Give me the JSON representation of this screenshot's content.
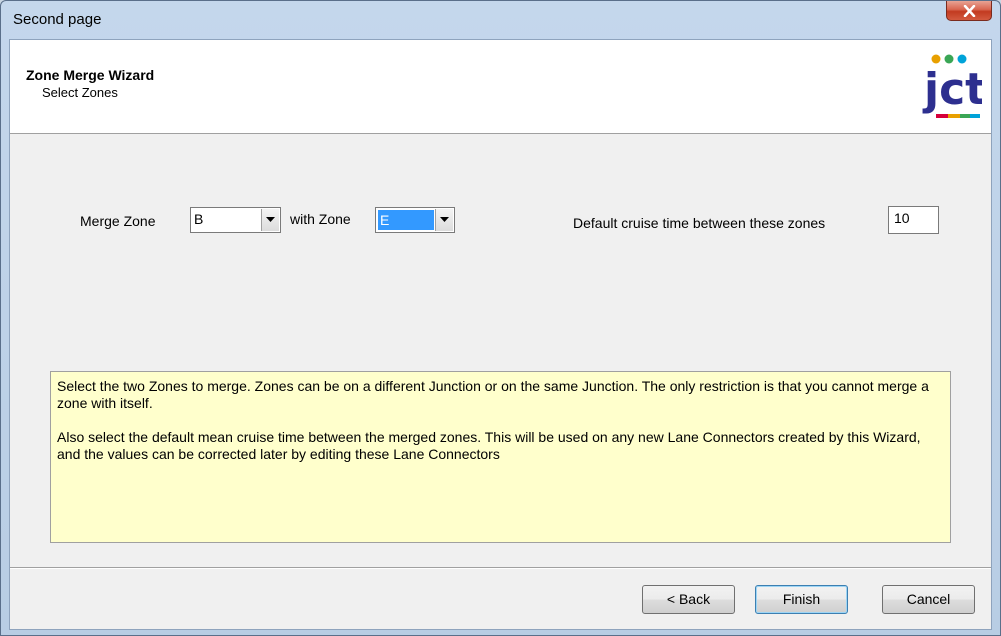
{
  "window": {
    "title": "Second page"
  },
  "wizard": {
    "title": "Zone Merge Wizard",
    "subtitle": "Select Zones"
  },
  "form": {
    "merge_label": "Merge Zone",
    "zone1_value": "B",
    "with_label": "with Zone",
    "zone2_value": "E",
    "cruise_label": "Default cruise time between these zones",
    "cruise_value": "10"
  },
  "help": {
    "paragraph1": "Select the two Zones to merge. Zones can be on a different Junction or on the same Junction. The only restriction is that you cannot merge a zone with itself.",
    "paragraph2": "Also select the default mean cruise time between the merged zones. This will be used on any new Lane Connectors created by this Wizard, and the values can be corrected later by editing these Lane Connectors"
  },
  "buttons": {
    "back": "< Back",
    "finish": "Finish",
    "cancel": "Cancel"
  },
  "logo": {
    "text": "jct",
    "colors": [
      "#2d2f8f",
      "#e8a000",
      "#3aa655",
      "#d6003a",
      "#00a3d9"
    ]
  },
  "icons": {
    "close": "close-icon",
    "dropdown": "chevron-down-icon"
  }
}
